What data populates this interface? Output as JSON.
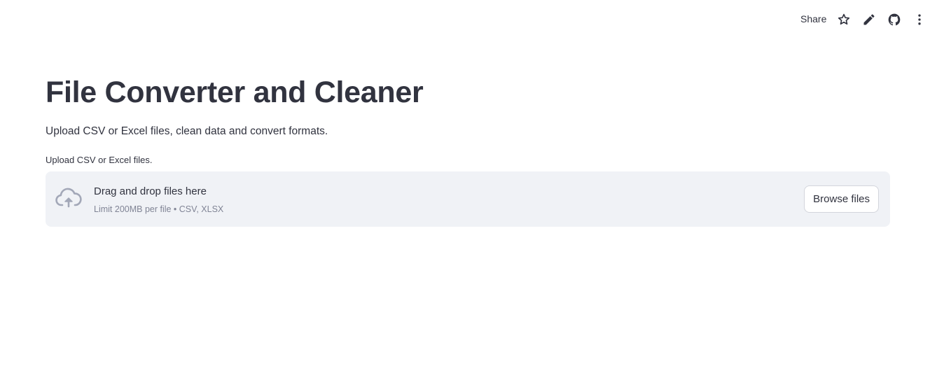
{
  "toolbar": {
    "share_label": "Share",
    "icons": [
      "star-icon",
      "edit-pencil-icon",
      "github-icon",
      "more-vertical-icon"
    ]
  },
  "main": {
    "title": "File Converter and Cleaner",
    "subtitle": "Upload CSV or Excel files, clean data and convert formats."
  },
  "uploader": {
    "label": "Upload CSV or Excel files.",
    "drop_text": "Drag and drop files here",
    "limit_text": "Limit 200MB per file • CSV, XLSX",
    "browse_label": "Browse files",
    "icon": "cloud-upload-icon"
  },
  "colors": {
    "text": "#31333f",
    "muted": "#808495",
    "dropzone_bg": "#f0f2f6",
    "icon_gray": "#a3a8b8"
  }
}
